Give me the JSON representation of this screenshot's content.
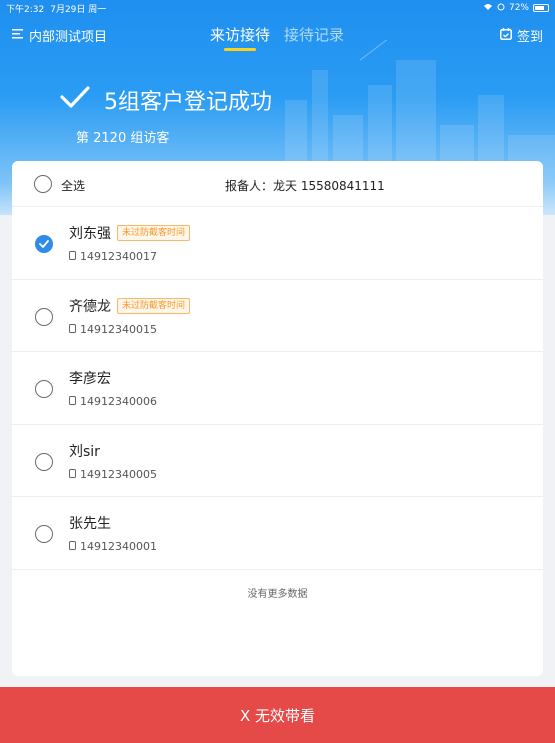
{
  "status_bar": {
    "time": "下午2:32",
    "date": "7月29日 周一",
    "battery": "72%"
  },
  "navbar": {
    "project": "内部测试项目",
    "tabs": [
      {
        "label": "来访接待",
        "active": true
      },
      {
        "label": "接待记录",
        "active": false
      }
    ],
    "checkin_label": "签到"
  },
  "banner": {
    "title": "5组客户登记成功",
    "subtitle": "第 2120 组访客"
  },
  "list": {
    "select_all_label": "全选",
    "reporter": "报备人：龙天 15580841111",
    "rows": [
      {
        "name": "刘东强",
        "tag": "未过防截客时间",
        "phone": "14912340017",
        "checked": true
      },
      {
        "name": "齐德龙",
        "tag": "未过防截客时间",
        "phone": "14912340015",
        "checked": false
      },
      {
        "name": "李彦宏",
        "tag": "",
        "phone": "14912340006",
        "checked": false
      },
      {
        "name": "刘sir",
        "tag": "",
        "phone": "14912340005",
        "checked": false
      },
      {
        "name": "张先生",
        "tag": "",
        "phone": "14912340001",
        "checked": false
      }
    ],
    "no_more_text": "没有更多数据"
  },
  "bottom_button_label": "X 无效带看",
  "colors": {
    "primary_blue": "#2f8ae8",
    "danger_red": "#e54948",
    "tag_orange": "#f39a2b",
    "tab_underline": "#ffd21a"
  }
}
